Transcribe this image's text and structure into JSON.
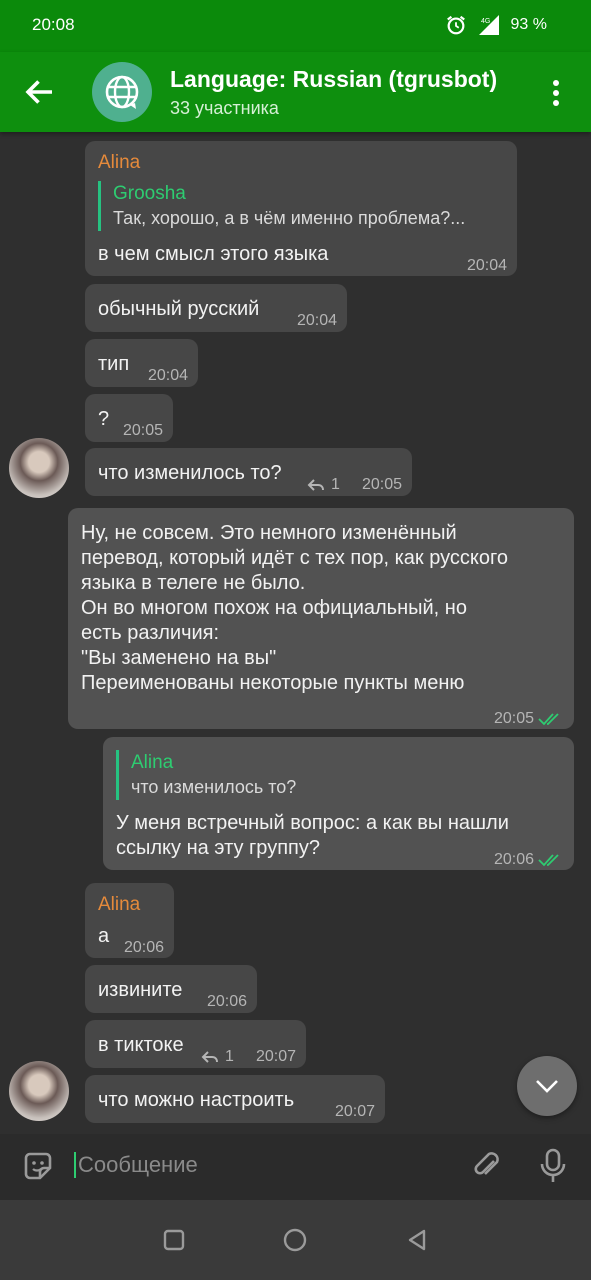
{
  "status_bar": {
    "time": "20:08",
    "battery": "93 %",
    "network": "4G"
  },
  "header": {
    "title": "Language: Russian (tgrusbot)",
    "subtitle": "33 участника"
  },
  "messages": [
    {
      "sender": "Alina",
      "reply_name": "Groosha",
      "reply_text": "Так, хорошо, а в чём именно проблема?...",
      "text": "в чем смысл этого языка",
      "time": "20:04"
    },
    {
      "text": "обычный русский",
      "time": "20:04"
    },
    {
      "text": "тип",
      "time": "20:04"
    },
    {
      "text": "?",
      "time": "20:05"
    },
    {
      "text": "что изменилось то?",
      "replies": "1",
      "time": "20:05"
    },
    {
      "lines": [
        "Ну, не совсем. Это немного изменённый",
        "перевод, который идёт с тех пор, как русского",
        "языка в телеге не было.",
        "Он во многом похож на официальный, но",
        "есть различия:",
        "\"Вы заменено на вы\"",
        "Переименованы некоторые пункты меню"
      ],
      "time": "20:05"
    },
    {
      "reply_name": "Alina",
      "reply_text": "что изменилось то?",
      "lines": [
        "У меня встречный вопрос: а как вы нашли",
        "ссылку на эту группу?"
      ],
      "time": "20:06"
    },
    {
      "sender": "Alina",
      "text": "а",
      "time": "20:06"
    },
    {
      "text": "извините",
      "time": "20:06"
    },
    {
      "text": "в тиктоке",
      "replies": "1",
      "time": "20:07"
    },
    {
      "text": "что можно настроить",
      "time": "20:07"
    }
  ],
  "composer": {
    "placeholder": "Сообщение"
  },
  "colors": {
    "header": "#0e8f0e",
    "sender_name": "#e58a3b",
    "reply_accent": "#2ecc71",
    "read_check": "#2ecc71"
  }
}
